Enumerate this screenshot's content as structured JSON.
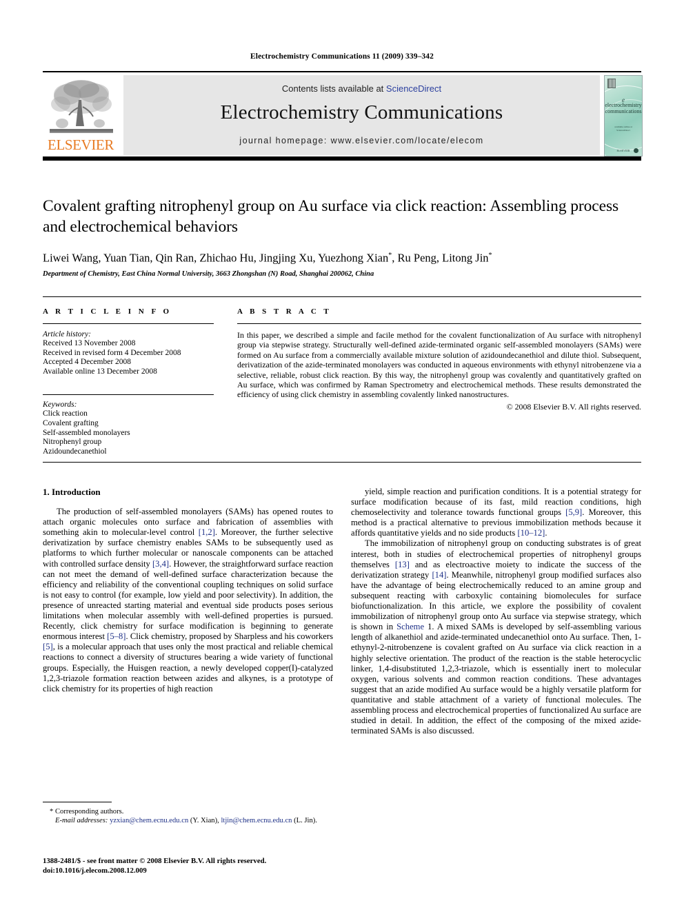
{
  "running_head": "Electrochemistry Communications 11 (2009) 339–342",
  "masthead": {
    "contents_prefix": "Contents lists available at ",
    "sciencedirect": "ScienceDirect",
    "journal_title": "Electrochemistry Communications",
    "homepage": "journal homepage: www.elsevier.com/locate/elecom",
    "publisher_wordmark": "ELSEVIER",
    "cover": {
      "at_glyph": "e",
      "line1": "electrochemistry",
      "line2": "communications",
      "mid_note": "available online at\nScienceDirect",
      "bottom_note": "ELSEVIER"
    },
    "link_color": "#2b3f9e",
    "brand_color": "#e87a22"
  },
  "article": {
    "title": "Covalent grafting nitrophenyl group on Au surface via click reaction: Assembling process and electrochemical behaviors",
    "authors": "Liwei Wang, Yuan Tian, Qin Ran, Zhichao Hu, Jingjing Xu, Yuezhong Xian *, Ru Peng, Litong Jin *",
    "affiliation": "Department of Chemistry, East China Normal University, 3663 Zhongshan (N) Road, Shanghai 200062, China"
  },
  "info": {
    "heading": "A R T I C L E   I N F O",
    "history_title": "Article history:",
    "history": [
      "Received 13 November 2008",
      "Received in revised form 4 December 2008",
      "Accepted 4 December 2008",
      "Available online 13 December 2008"
    ],
    "keywords_title": "Keywords:",
    "keywords": [
      "Click reaction",
      "Covalent grafting",
      "Self-assembled monolayers",
      "Nitrophenyl group",
      "Azidoundecanethiol"
    ]
  },
  "abstract": {
    "heading": "A B S T R A C T",
    "text": "In this paper, we described a simple and facile method for the covalent functionalization of Au surface with nitrophenyl group via stepwise strategy. Structurally well-defined azide-terminated organic self-assembled monolayers (SAMs) were formed on Au surface from a commercially available mixture solution of azidoundecanethiol and dilute thiol. Subsequent, derivatization of the azide-terminated monolayers was conducted in aqueous environments with ethynyl nitrobenzene via a selective, reliable, robust click reaction. By this way, the nitrophenyl group was covalently and quantitatively grafted on Au surface, which was confirmed by Raman Spectrometry and electrochemical methods. These results demonstrated the efficiency of using click chemistry in assembling covalently linked nanostructures.",
    "copyright": "© 2008 Elsevier B.V. All rights reserved."
  },
  "body": {
    "section_heading": "1. Introduction",
    "left_paragraphs": [
      "The production of self-assembled monolayers (SAMs) has opened routes to attach organic molecules onto surface and fabrication of assemblies with something akin to molecular-level control [1,2]. Moreover, the further selective derivatization by surface chemistry enables SAMs to be subsequently used as platforms to which further molecular or nanoscale components can be attached with controlled surface density [3,4]. However, the straightforward surface reaction can not meet the demand of well-defined surface characterization because the efficiency and reliability of the conventional coupling techniques on solid surface is not easy to control (for example, low yield and poor selectivity). In addition, the presence of unreacted starting material and eventual side products poses serious limitations when molecular assembly with well-defined properties is pursued. Recently, click chemistry for surface modification is beginning to generate enormous interest [5–8]. Click chemistry, proposed by Sharpless and his coworkers [5], is a molecular approach that uses only the most practical and reliable chemical reactions to connect a diversity of structures bearing a wide variety of functional groups. Especially, the Huisgen reaction, a newly developed copper(I)-catalyzed 1,2,3-triazole formation reaction between azides and alkynes, is a prototype of click chemistry for its properties of high reaction"
    ],
    "right_paragraphs": [
      "yield, simple reaction and purification conditions. It is a potential strategy for surface modification because of its fast, mild reaction conditions, high chemoselectivity and tolerance towards functional groups [5,9]. Moreover, this method is a practical alternative to previous immobilization methods because it affords quantitative yields and no side products [10–12].",
      "The immobilization of nitrophenyl group on conducting substrates is of great interest, both in studies of electrochemical properties of nitrophenyl groups themselves [13] and as electroactive moiety to indicate the success of the derivatization strategy [14]. Meanwhile, nitrophenyl group modified surfaces also have the advantage of being electrochemically reduced to an amine group and subsequent reacting with carboxylic containing biomolecules for surface biofunctionalization. In this article, we explore the possibility of covalent immobilization of nitrophenyl group onto Au surface via stepwise strategy, which is shown in Scheme 1. A mixed SAMs is developed by self-assembling various length of alkanethiol and azide-terminated undecanethiol onto Au surface. Then, 1-ethynyl-2-nitrobenzene is covalent grafted on Au surface via click reaction in a highly selective orientation. The product of the reaction is the stable heterocyclic linker, 1,4-disubstituted 1,2,3-triazole, which is essentially inert to molecular oxygen, various solvents and common reaction conditions. These advantages suggest that an azide modified Au surface would be a highly versatile platform for quantitative and stable attachment of a variety of functional molecules. The assembling process and electrochemical properties of functionalized Au surface are studied in detail. In addition, the effect of the composing of the mixed azide-terminated SAMs is also discussed."
    ]
  },
  "footnote": {
    "corresponding_marker": "*",
    "corresponding": "Corresponding authors.",
    "email_label": "E-mail addresses:",
    "email1": "yzxian@chem.ecnu.edu.cn",
    "email1_owner": "(Y. Xian),",
    "email2": "ltjin@chem.ecnu.edu.cn",
    "email2_owner": "(L. Jin)."
  },
  "imprint": {
    "issn_line": "1388-2481/$ - see front matter © 2008 Elsevier B.V. All rights reserved.",
    "doi_line": "doi:10.1016/j.elecom.2008.12.009"
  }
}
